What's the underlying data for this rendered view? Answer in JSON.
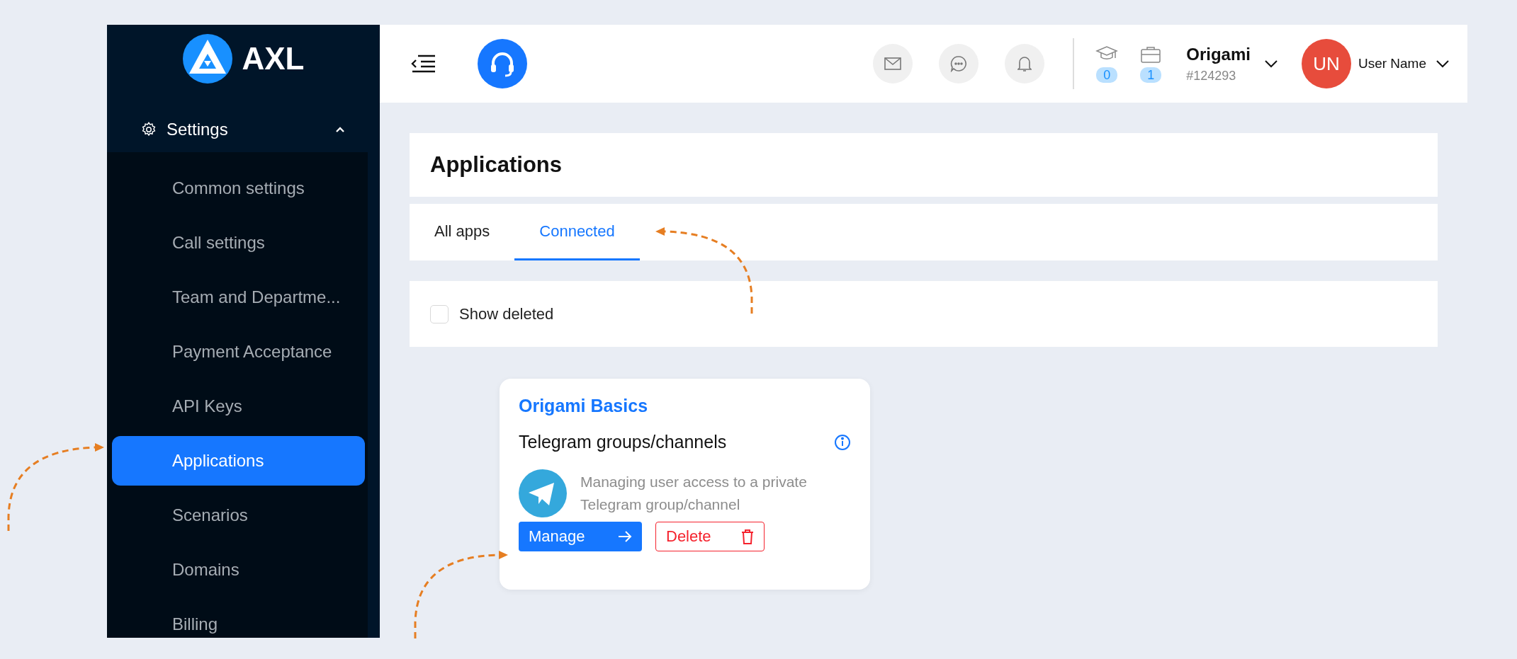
{
  "sidebar": {
    "logo_text": "AXL",
    "section": {
      "label": "Settings",
      "expanded": true
    },
    "items": [
      {
        "label": "Common settings",
        "selected": false
      },
      {
        "label": "Call settings",
        "selected": false
      },
      {
        "label": "Team and Departme...",
        "selected": false
      },
      {
        "label": "Payment Acceptance",
        "selected": false
      },
      {
        "label": "API Keys",
        "selected": false
      },
      {
        "label": "Applications",
        "selected": true
      },
      {
        "label": "Scenarios",
        "selected": false
      },
      {
        "label": "Domains",
        "selected": false
      },
      {
        "label": "Billing",
        "selected": false
      }
    ]
  },
  "header": {
    "counters": [
      {
        "kind": "courses",
        "count": "0"
      },
      {
        "kind": "cases",
        "count": "1"
      }
    ],
    "company": {
      "name": "Origami",
      "id": "#124293"
    },
    "user": {
      "initials": "UN",
      "name": "User Name"
    }
  },
  "page": {
    "title": "Applications"
  },
  "tabs": [
    {
      "label": "All apps",
      "selected": false
    },
    {
      "label": "Connected",
      "selected": true
    }
  ],
  "filter": {
    "label": "Show deleted",
    "checked": false
  },
  "app_cards": [
    {
      "provider": "Origami Basics",
      "name": "Telegram groups/channels",
      "description": "Managing user access to a private Telegram group/channel",
      "buttons": [
        {
          "kind": "manage",
          "label": "Manage"
        },
        {
          "kind": "delete",
          "label": "Delete"
        }
      ]
    }
  ]
}
